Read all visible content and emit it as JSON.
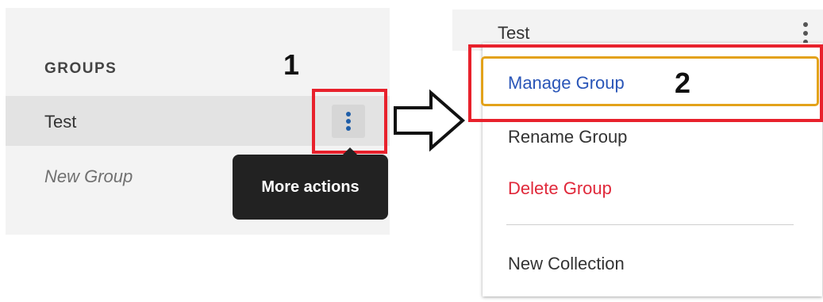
{
  "left": {
    "section_label": "GROUPS",
    "group_row_label": "Test",
    "new_group_label": "New Group",
    "tooltip": "More actions",
    "step_label": "1"
  },
  "right": {
    "header_label": "Test",
    "menu_items": [
      "Manage Group",
      "Rename Group",
      "Delete Group",
      "New Collection"
    ],
    "step_label": "2"
  },
  "colors": {
    "highlight_red": "#e8212c",
    "focus_ring": "#e3a21a",
    "link_blue": "#2a56b8",
    "danger_red": "#e0283a",
    "dots_blue": "#1f5ea8"
  },
  "icons": {
    "more_actions": "more-vertical-icon",
    "arrow": "right-arrow-icon"
  }
}
